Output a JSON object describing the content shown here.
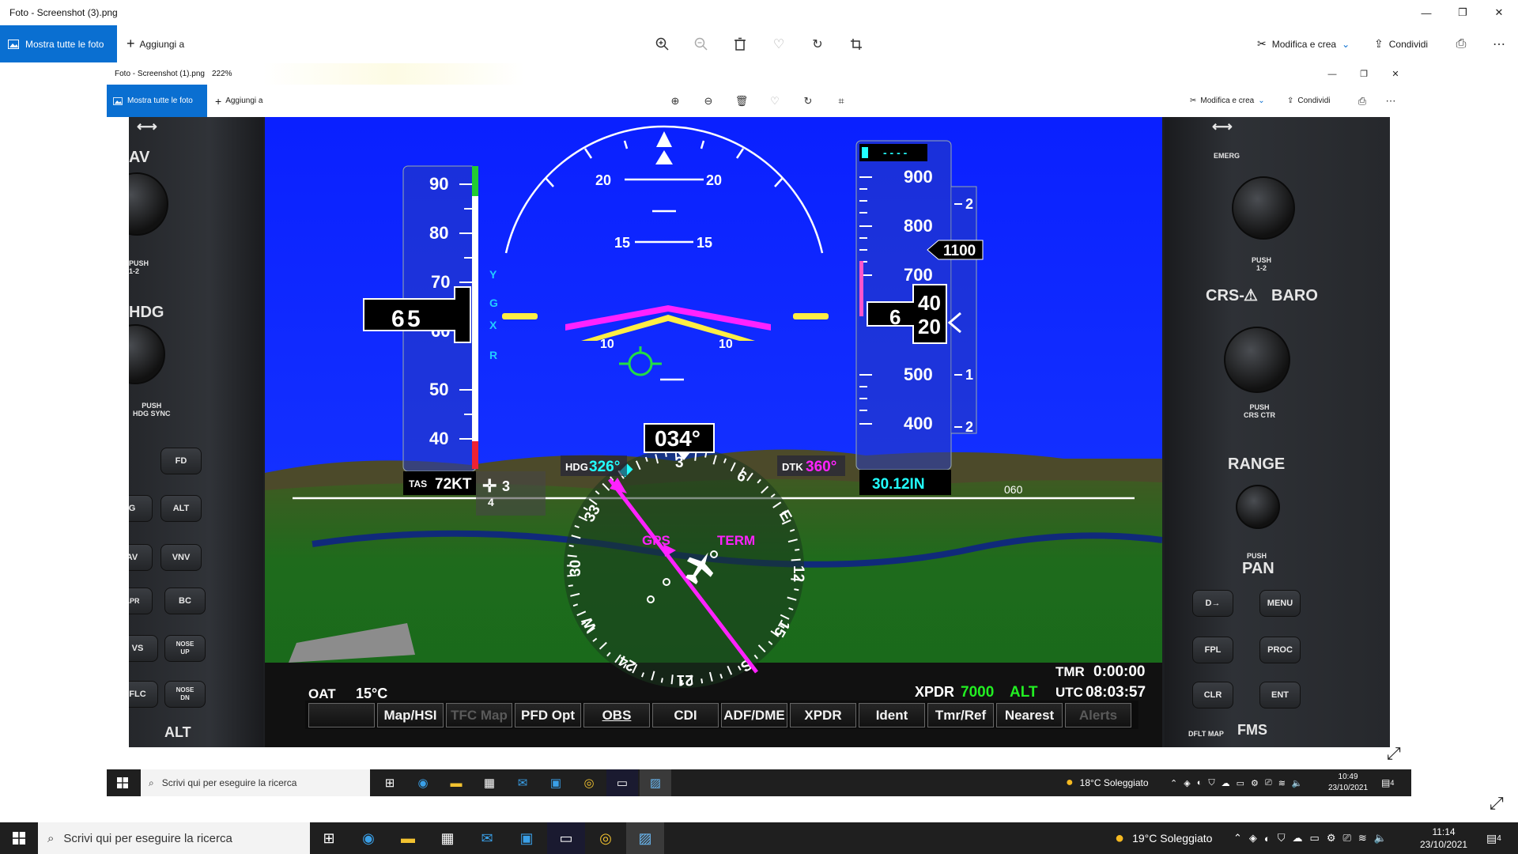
{
  "outer": {
    "title": "Foto - Screenshot (3).png",
    "show_all": "Mostra tutte le foto",
    "add_to": "Aggiungi a",
    "edit_create": "Modifica e crea",
    "share": "Condividi"
  },
  "inner": {
    "title": "Foto - Screenshot (1).png",
    "zoom": "222%",
    "show_all": "Mostra tutte le foto",
    "add_to": "Aggiungi a",
    "edit_create": "Modifica e crea",
    "share": "Condividi"
  },
  "pfd": {
    "pitch_labels": {
      "p20": "20",
      "p15": "15",
      "p10": "10"
    },
    "airspeed": {
      "ticks": [
        "90",
        "80",
        "70",
        "60",
        "50",
        "40"
      ],
      "current_tens": "6",
      "current_ones": "5",
      "tas_label": "TAS",
      "tas_value": "72KT",
      "marker_y": "Y",
      "marker_g": "G",
      "marker_x": "X",
      "marker_r": "R"
    },
    "altitude": {
      "ticks": [
        "900",
        "800",
        "700",
        "500",
        "400"
      ],
      "current_hundreds": "6",
      "roll_up": "40",
      "roll_down": "20",
      "selected_alt": "1100",
      "selected_dashes": "- - - -",
      "baro": "30.12IN",
      "vsi_labels": [
        "2",
        "1",
        "1",
        "2"
      ]
    },
    "hsi": {
      "heading": "034°",
      "hdg_label": "HDG",
      "hdg_value": "326°",
      "dtk_label": "DTK",
      "dtk_value": "360°",
      "source": "GPS",
      "phase": "TERM",
      "compass": [
        "3",
        "6",
        "E",
        "12",
        "15",
        "S",
        "21",
        "24",
        "W",
        "30",
        "33"
      ]
    },
    "wind": {
      "value_a": "3",
      "value_b": "4"
    },
    "heading_tape": "060",
    "oat_label": "OAT",
    "oat_value": "15°C",
    "xpdr_label": "XPDR",
    "xpdr_code": "7000",
    "xpdr_mode": "ALT",
    "tmr_label": "TMR",
    "tmr_value": "0:00:00",
    "utc_label": "UTC",
    "utc_value": "08:03:57",
    "softkeys": [
      "",
      "Map/HSI",
      "TFC Map",
      "PFD Opt",
      "OBS",
      "CDI",
      "ADF/DME",
      "XPDR",
      "Ident",
      "Tmr/Ref",
      "Nearest",
      "Alerts"
    ]
  },
  "panel_left": {
    "nav_label": "AV",
    "push12": "PUSH\n1-2",
    "hdg": "HDG",
    "push_hdg": "PUSH\nHDG SYNC",
    "alt": "ALT",
    "buttons": [
      "FD",
      "ALT",
      "VNV",
      "BC",
      "NOSE\nUP",
      "NOSE\nDN"
    ],
    "buttons_left": [
      "G",
      "AV",
      "APR",
      "VS",
      "FLC"
    ]
  },
  "panel_right": {
    "emerg": "EMERG",
    "push12": "PUSH\n1-2",
    "crs_baro": "CRS-",
    "baro": "BARO",
    "push_crs": "PUSH\nCRS CTR",
    "range": "RANGE",
    "push": "PUSH",
    "pan": "PAN",
    "fms": "FMS",
    "dflt_map": "DFLT MAP",
    "keys": [
      "D→",
      "MENU",
      "FPL",
      "PROC",
      "CLR",
      "ENT"
    ]
  },
  "taskbar_inner": {
    "search": "Scrivi qui per eseguire la ricerca",
    "weather": "18°C  Soleggiato",
    "time": "10:49",
    "date": "23/10/2021",
    "notif": "4"
  },
  "taskbar_outer": {
    "search": "Scrivi qui per eseguire la ricerca",
    "weather": "19°C  Soleggiato",
    "time": "11:14",
    "date": "23/10/2021",
    "notif": "4"
  }
}
